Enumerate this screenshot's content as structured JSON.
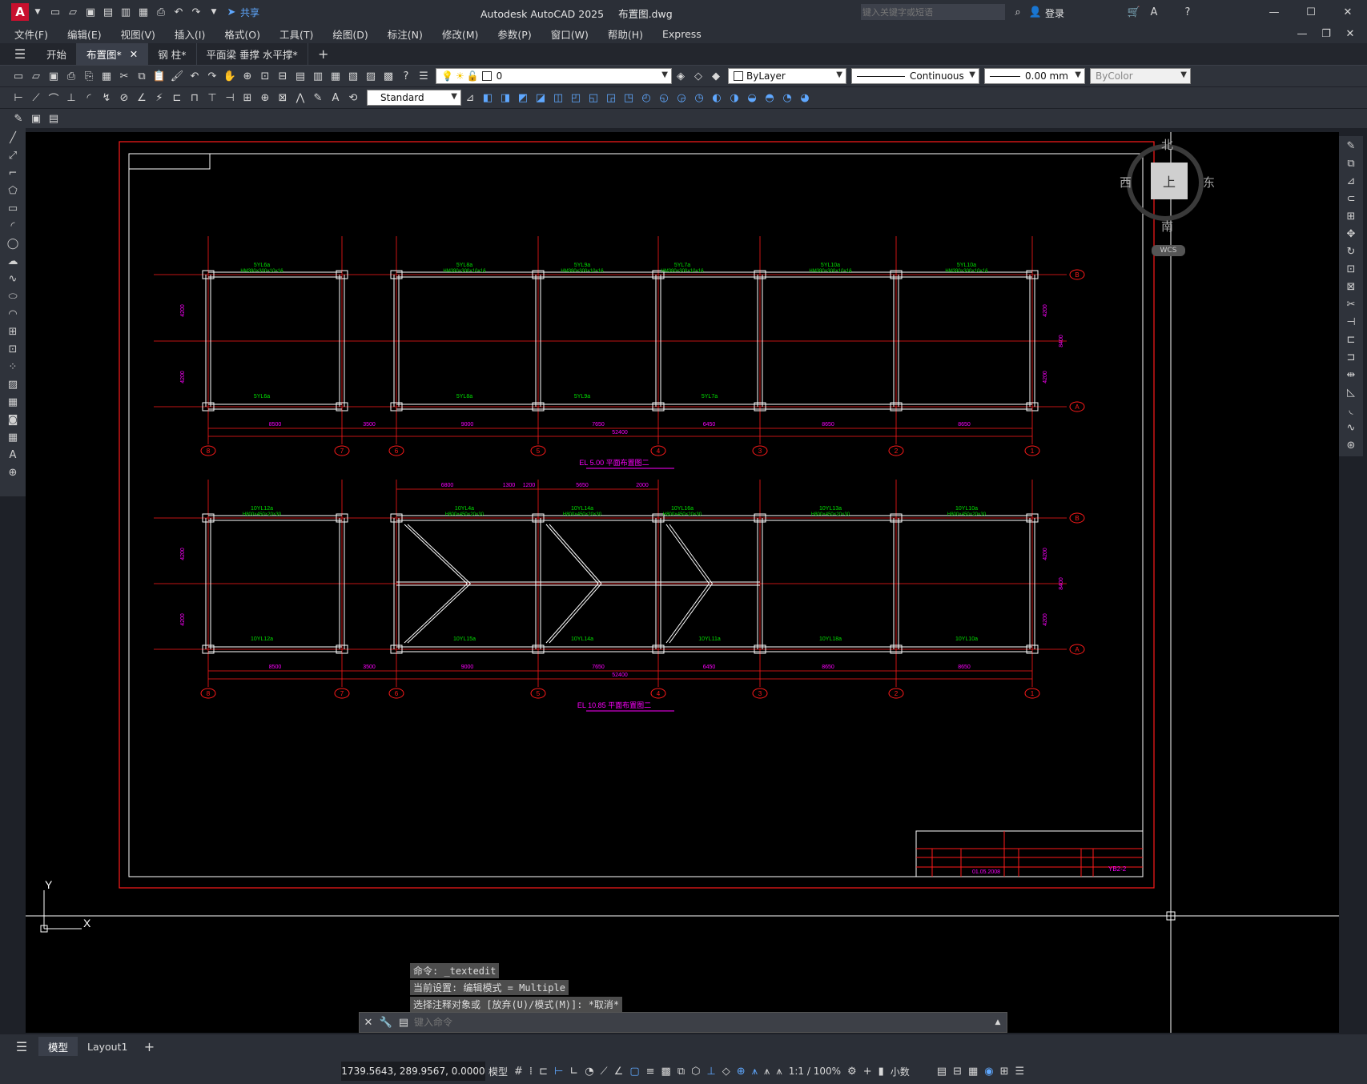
{
  "app": {
    "title": "Autodesk AutoCAD 2025",
    "filename": "布置图.dwg",
    "logo": "A",
    "share_label": "共享",
    "search_placeholder": "键入关键字或短语",
    "login_label": "登录"
  },
  "menu": [
    "文件(F)",
    "编辑(E)",
    "视图(V)",
    "插入(I)",
    "格式(O)",
    "工具(T)",
    "绘图(D)",
    "标注(N)",
    "修改(M)",
    "参数(P)",
    "窗口(W)",
    "帮助(H)",
    "Express"
  ],
  "doc_tabs": [
    {
      "label": "开始",
      "active": false
    },
    {
      "label": "布置图*",
      "active": true
    },
    {
      "label": "钢 柱*",
      "active": false
    },
    {
      "label": "平面梁 垂撑 水平撑*",
      "active": false
    }
  ],
  "properties": {
    "layer": "0",
    "color": "ByLayer",
    "linetype": "Continuous",
    "lineweight": "0.00 mm",
    "plotstyle": "ByColor",
    "textstyle": "Standard"
  },
  "viewcube": {
    "north": "北",
    "south": "南",
    "east": "东",
    "west": "西",
    "face": "上",
    "wcs": "WCS"
  },
  "drawing": {
    "plan1": {
      "elevation": "EL 5.00",
      "subtitle": "平面布置图二",
      "total_dim": "52400",
      "spans": [
        "8500",
        "3500",
        "9000",
        "7650",
        "6450",
        "8650",
        "8650"
      ],
      "side_dims": [
        "4200",
        "4200",
        "8400"
      ],
      "beam_labels": [
        "5YL6a",
        "5YL8a",
        "5YL9a",
        "5YL7a",
        "5YL10a",
        "5YL10a",
        "5YL6a",
        "5YL8a",
        "5YL9a",
        "5YL7a"
      ],
      "section_top": "HM390×300×10×16"
    },
    "plan2": {
      "elevation": "EL 10.85",
      "subtitle": "平面布置图二",
      "total_dim": "52400",
      "spans": [
        "8500",
        "3500",
        "9000",
        "7650",
        "6450",
        "8650",
        "8650"
      ],
      "top_dims": [
        "6800",
        "1300",
        "1200",
        "5650",
        "2000"
      ],
      "side_dims": [
        "4200",
        "4200",
        "8400"
      ],
      "beam_labels": [
        "10YL12a",
        "10YL4a",
        "10YL14a",
        "10YL16a",
        "10YL13a",
        "10YL10a",
        "10YL12a",
        "10YL15a",
        "10YL14a",
        "10YL11a",
        "10YL18a",
        "10YL10a"
      ],
      "section_top": "H800×450×20×30"
    },
    "axis_labels": [
      "8",
      "7",
      "6",
      "5",
      "4",
      "3",
      "2",
      "1"
    ],
    "row_labels": [
      "B",
      "A"
    ],
    "titleblock_id": "YB2-2",
    "titleblock_date": "01.05.2008"
  },
  "command": {
    "history": [
      "命令: _textedit",
      "当前设置: 编辑模式 = Multiple",
      "选择注释对象或 [放弃(U)/模式(M)]: *取消*"
    ],
    "placeholder": "键入命令"
  },
  "layout_tabs": [
    {
      "label": "模型",
      "active": true
    },
    {
      "label": "Layout1",
      "active": false
    }
  ],
  "status": {
    "coords": "1739.5643, 289.9567, 0.0000",
    "space": "模型",
    "scale": "1:1 / 100%",
    "units": "小数"
  },
  "colors": {
    "red": "#ff1a1a",
    "green": "#00e000",
    "magenta": "#ff00ff",
    "white": "#ffffff",
    "background": "#000000"
  }
}
